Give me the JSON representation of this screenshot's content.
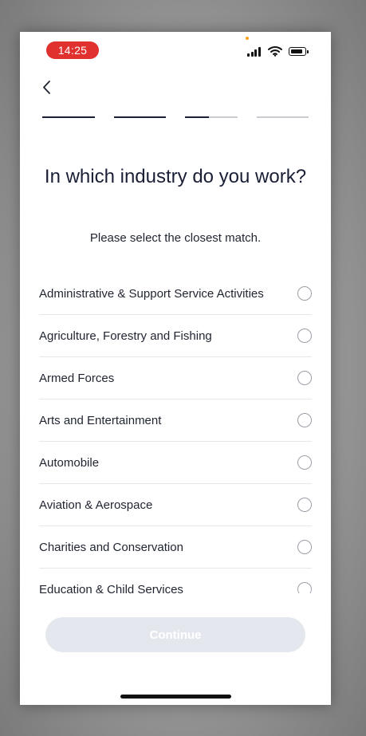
{
  "status_bar": {
    "time": "14:25",
    "time_pill_color": "#e0312f",
    "privacy_dot_color": "#f7a21b"
  },
  "nav": {
    "back_icon": "chevron-left-icon"
  },
  "progress": {
    "steps_total": 4,
    "current_step": 3,
    "current_step_fraction": 0.45
  },
  "question": {
    "title": "In which industry do you work?",
    "subtitle": "Please select the closest match."
  },
  "options": [
    {
      "label": "Administrative & Support Service Activities",
      "selected": false
    },
    {
      "label": "Agriculture, Forestry and Fishing",
      "selected": false
    },
    {
      "label": "Armed Forces",
      "selected": false
    },
    {
      "label": "Arts and Entertainment",
      "selected": false
    },
    {
      "label": "Automobile",
      "selected": false
    },
    {
      "label": "Aviation & Aerospace",
      "selected": false
    },
    {
      "label": "Charities and Conservation",
      "selected": false
    },
    {
      "label": "Education & Child Services",
      "selected": false
    }
  ],
  "continue_button": {
    "label": "Continue",
    "enabled": false,
    "color": "#e4e8ee"
  },
  "colors": {
    "text_primary": "#1a1f36",
    "divider": "#e6e8ec",
    "radio_border": "#9b9fa6"
  }
}
